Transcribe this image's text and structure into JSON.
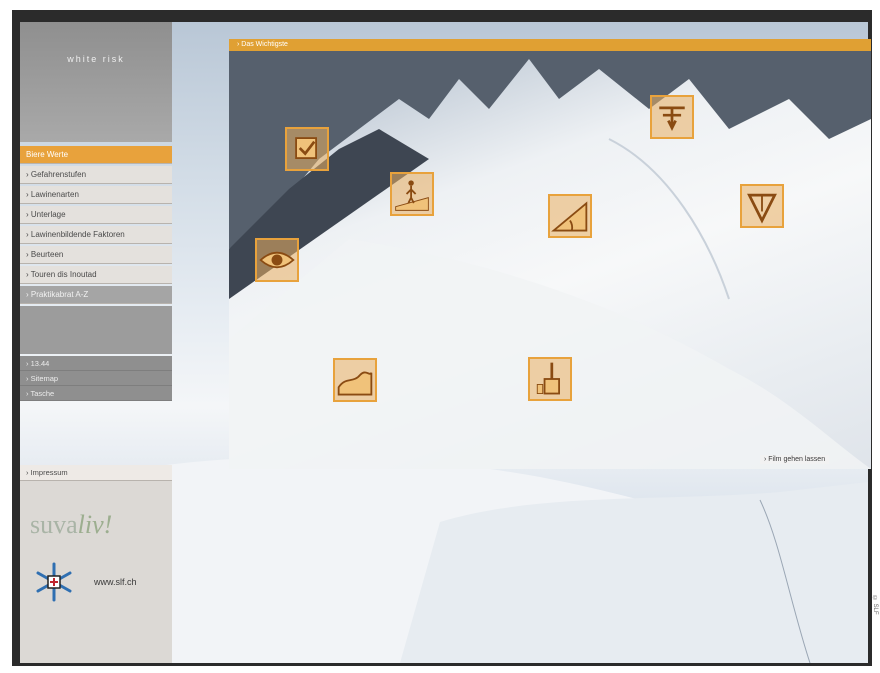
{
  "sidebar": {
    "logo": "white risk",
    "nav": [
      {
        "label": "Biere Werte",
        "state": "active"
      },
      {
        "label": "› Gefahrenstufen",
        "state": "normal"
      },
      {
        "label": "› Lawinenarten",
        "state": "normal"
      },
      {
        "label": "› Unterlage",
        "state": "normal"
      },
      {
        "label": "› Lawinenbildende Faktoren",
        "state": "normal"
      },
      {
        "label": "› Beurteen",
        "state": "normal"
      },
      {
        "label": "› Touren dis Inoutad",
        "state": "normal"
      },
      {
        "label": "› Praktikabrat A-Z",
        "state": "dark"
      }
    ],
    "sub_items": [
      "› 13.44",
      "› Sitemap",
      "› Tasche"
    ],
    "partner": {
      "heading": "› Impressum",
      "suva_a": "suva",
      "suva_b": "liv!",
      "slf": "www.slf.ch"
    }
  },
  "main": {
    "header": "› Das Wichtigste",
    "footer_link": "› Film gehen lassen",
    "icons": [
      {
        "name": "checkbox-icon"
      },
      {
        "name": "person-on-slope-icon"
      },
      {
        "name": "slope-angle-icon"
      },
      {
        "name": "wind-icon"
      },
      {
        "name": "avalanche-fracture-icon"
      },
      {
        "name": "eye-icon"
      },
      {
        "name": "terrain-icon"
      },
      {
        "name": "shovel-icon"
      }
    ]
  },
  "side_caption": "© SLF"
}
